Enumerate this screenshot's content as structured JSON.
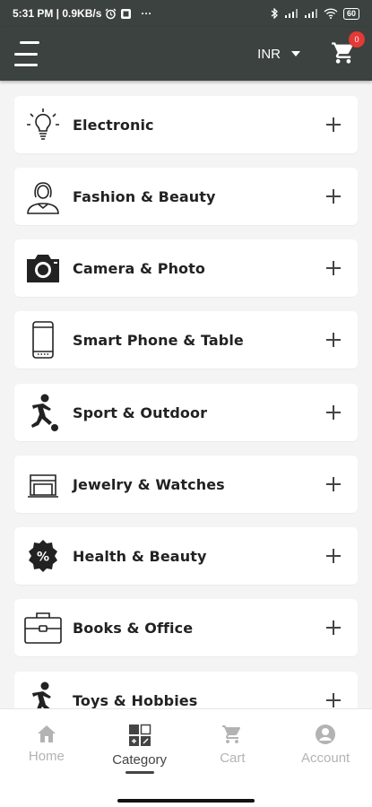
{
  "status_bar": {
    "time_speed": "5:31 PM | 0.9KB/s",
    "dots": "···",
    "battery": "60"
  },
  "app_bar": {
    "currency": "INR",
    "cart_count": "0"
  },
  "categories": [
    {
      "label": "Electronic",
      "icon": "lightbulb-icon"
    },
    {
      "label": "Fashion & Beauty",
      "icon": "woman-icon"
    },
    {
      "label": "Camera & Photo",
      "icon": "camera-icon"
    },
    {
      "label": "Smart Phone & Table",
      "icon": "smartphone-icon"
    },
    {
      "label": "Sport & Outdoor",
      "icon": "football-player-icon"
    },
    {
      "label": "Jewelry & Watches",
      "icon": "jewelry-box-icon"
    },
    {
      "label": "Health & Beauty",
      "icon": "percent-badge-icon"
    },
    {
      "label": "Books & Office",
      "icon": "briefcase-icon"
    },
    {
      "label": "Toys & Hobbies",
      "icon": "football-player-icon"
    }
  ],
  "bottom_nav": {
    "items": [
      {
        "label": "Home",
        "icon": "home-icon",
        "active": false
      },
      {
        "label": "Category",
        "icon": "category-grid-icon",
        "active": true
      },
      {
        "label": "Cart",
        "icon": "cart-icon",
        "active": false
      },
      {
        "label": "Account",
        "icon": "account-icon",
        "active": false
      }
    ]
  },
  "colors": {
    "app_bar": "#3b4240",
    "badge": "#e53935",
    "background": "#f4f4f4",
    "active_nav": "#444444",
    "inactive_nav": "#b3b3b3"
  }
}
